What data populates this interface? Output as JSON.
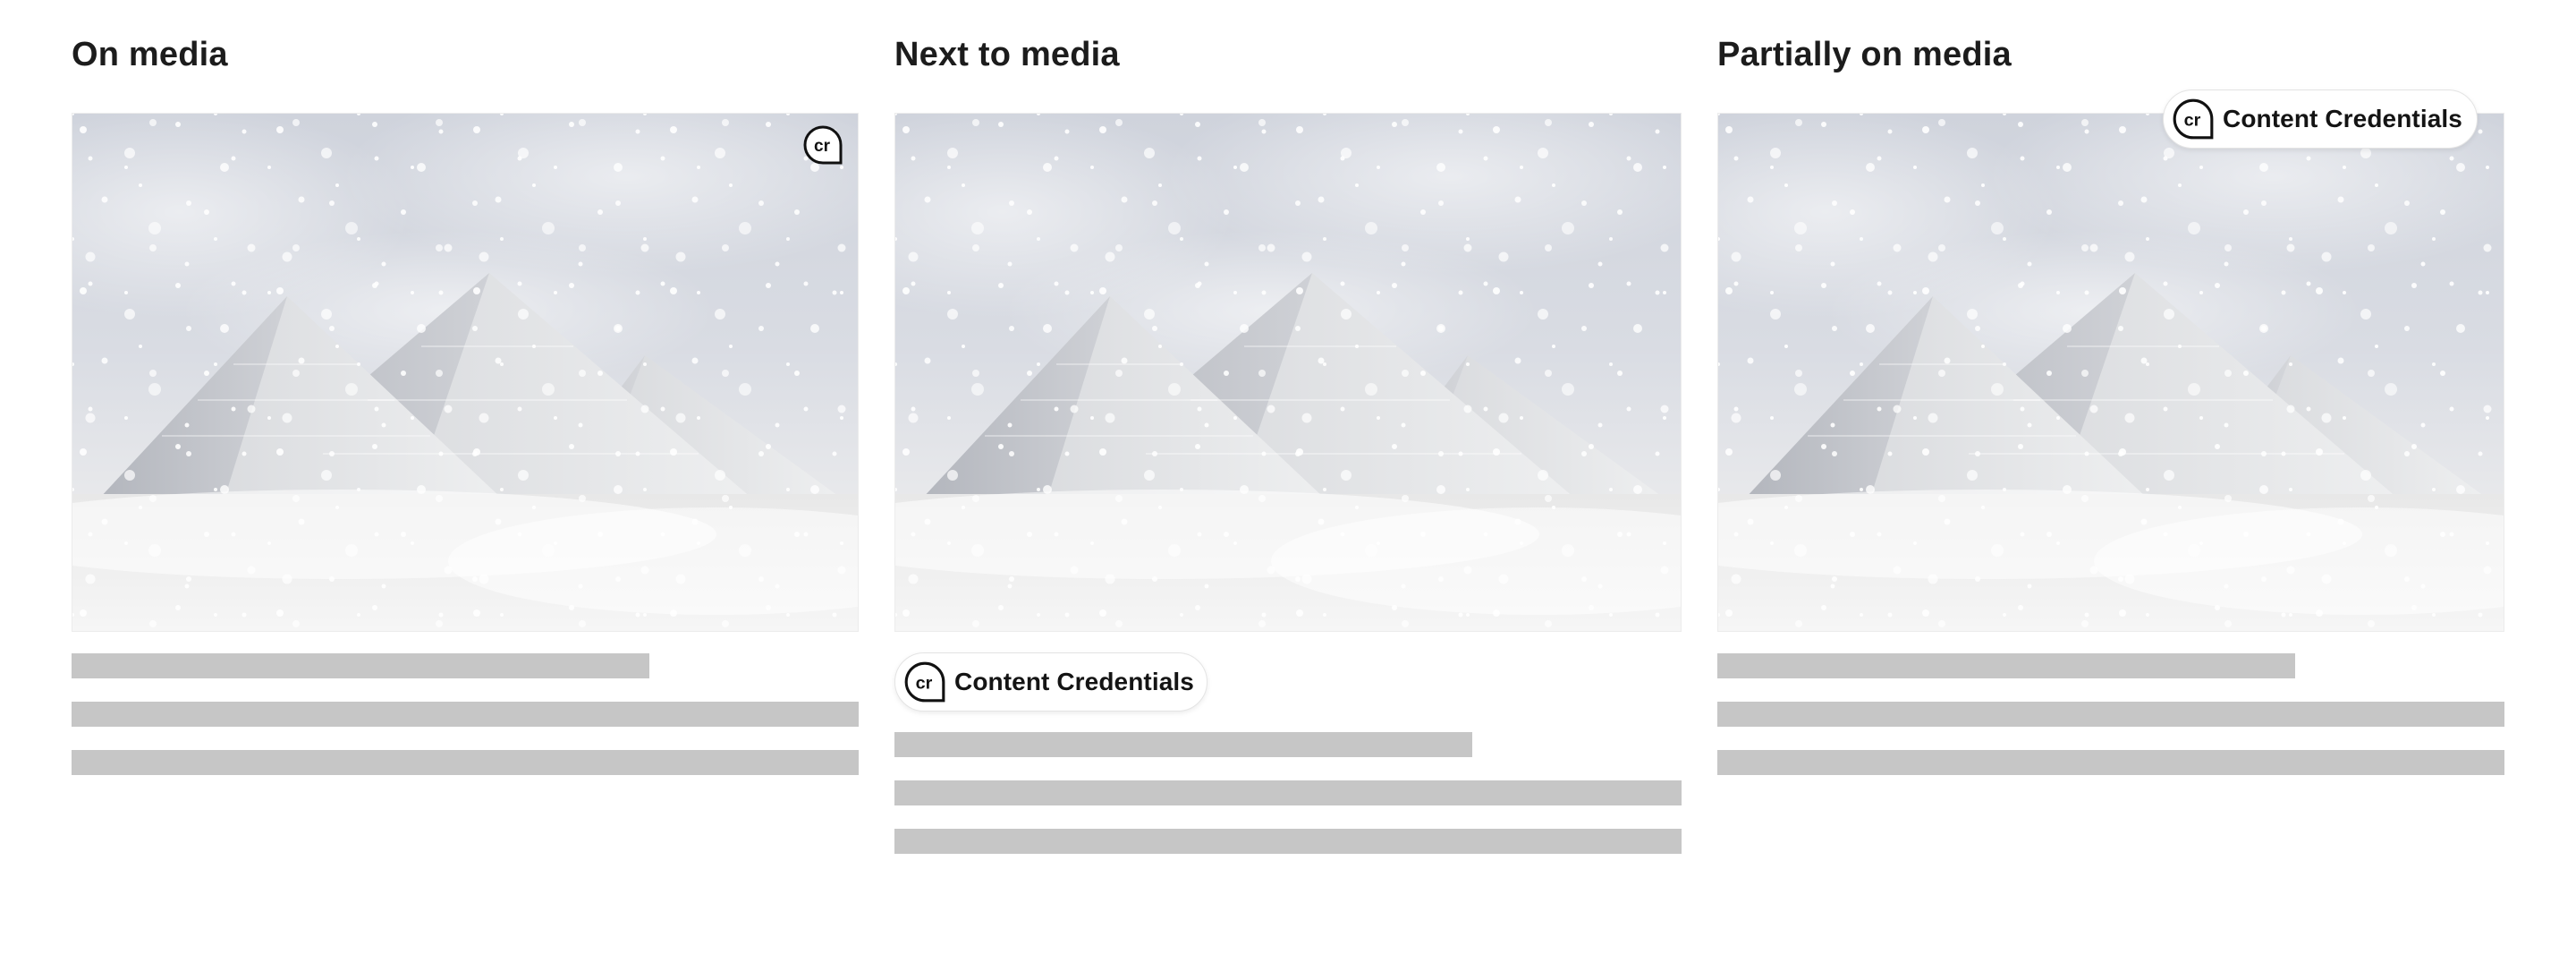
{
  "columns": [
    {
      "title": "On media",
      "media_alt": "Pyramids covered in snow during a snowstorm",
      "badge": {
        "icon": "content-credentials-cr-icon",
        "variant": "icon-only"
      }
    },
    {
      "title": "Next to media",
      "media_alt": "Pyramids covered in snow during a snowstorm",
      "badge": {
        "icon": "content-credentials-cr-icon",
        "label": "Content Credentials",
        "variant": "pill-next-to-media"
      }
    },
    {
      "title": "Partially on media",
      "media_alt": "Pyramids covered in snow during a snowstorm",
      "badge": {
        "icon": "content-credentials-cr-icon",
        "label": "Content Credentials",
        "variant": "pill-partially-on-media"
      }
    }
  ],
  "colors": {
    "placeholder_bar": "#c6c6c6",
    "title_text": "#1c1c1c",
    "pill_border": "#e4e4e4"
  }
}
